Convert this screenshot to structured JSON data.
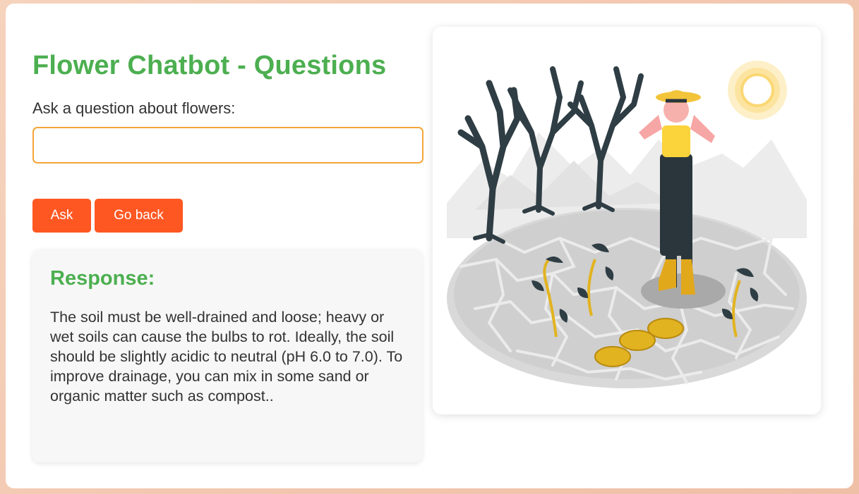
{
  "page": {
    "title": "Flower Chatbot - Questions",
    "question_label": "Ask a question about flowers:",
    "question_value": "",
    "question_placeholder": ""
  },
  "buttons": {
    "ask_label": "Ask",
    "back_label": "Go back"
  },
  "response": {
    "heading": "Response:",
    "text": "The soil must be well-drained and loose; heavy or wet soils can cause the bulbs to rot. Ideally, the soil should be slightly acidic to neutral (pH 6.0 to 7.0). To improve drainage, you can mix in some sand or organic matter such as compost.."
  },
  "illustration": {
    "icon": "dry-soil-farmer-illustration"
  },
  "colors": {
    "title_green": "#4caf50",
    "button_orange": "#ff5722",
    "input_border": "#f4a53a",
    "response_bg": "#f7f7f7"
  }
}
